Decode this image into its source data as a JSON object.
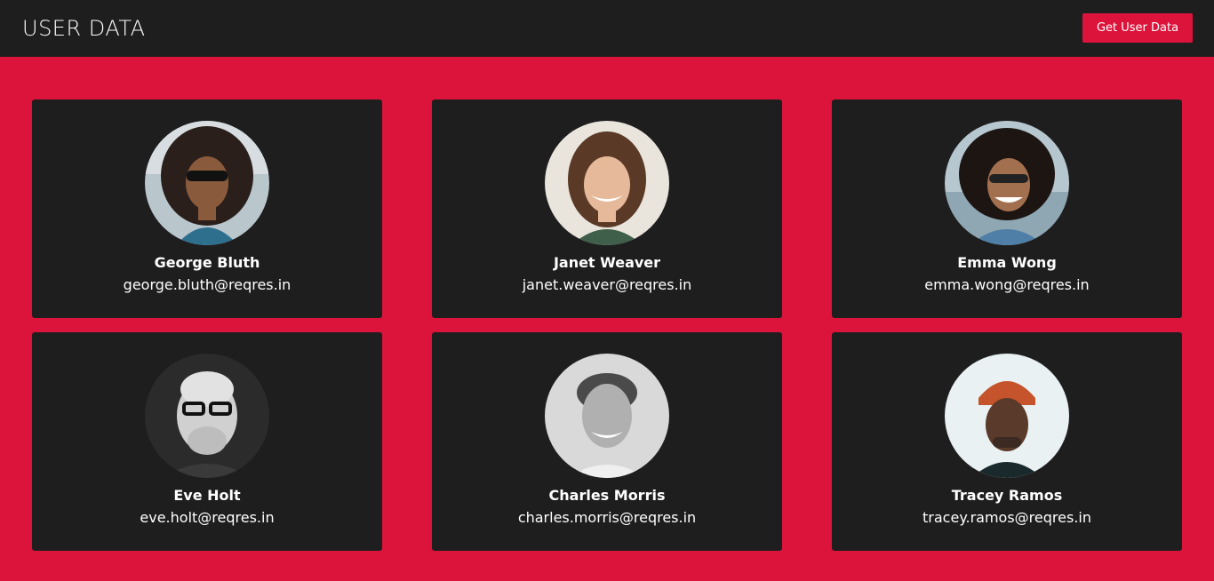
{
  "header": {
    "title": "USER DATA",
    "get_button_label": "Get User Data"
  },
  "colors": {
    "accent": "#dc143c",
    "panel": "#1e1e1f",
    "text": "#ffffff"
  },
  "users": [
    {
      "name": "George Bluth",
      "email": "george.bluth@reqres.in",
      "avatar_icon": "user-avatar-photo"
    },
    {
      "name": "Janet Weaver",
      "email": "janet.weaver@reqres.in",
      "avatar_icon": "user-avatar-photo"
    },
    {
      "name": "Emma Wong",
      "email": "emma.wong@reqres.in",
      "avatar_icon": "user-avatar-photo"
    },
    {
      "name": "Eve Holt",
      "email": "eve.holt@reqres.in",
      "avatar_icon": "user-avatar-photo"
    },
    {
      "name": "Charles Morris",
      "email": "charles.morris@reqres.in",
      "avatar_icon": "user-avatar-photo"
    },
    {
      "name": "Tracey Ramos",
      "email": "tracey.ramos@reqres.in",
      "avatar_icon": "user-avatar-photo"
    }
  ]
}
